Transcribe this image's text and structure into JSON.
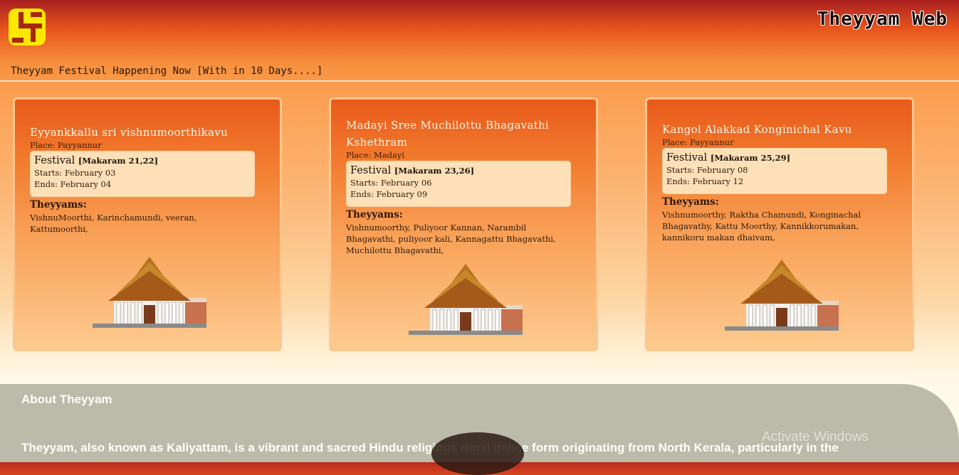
{
  "header": {
    "brand": "Theyyam Web",
    "headline": "Theyyam Festival Happening Now [With in 10 Days....]",
    "logo_icon": "swastika-icon"
  },
  "festivals": [
    {
      "title": "Eyyankkallu sri vishnumoorthikavu",
      "place": "Place: Payyannur",
      "festival_label": "Festival",
      "festival_dates": "[Makaram 21,22]",
      "starts": "Starts: February 03",
      "ends": "Ends: February 04",
      "theyyams_label": "Theyyams:",
      "theyyams": "VishnuMoorthi, Karinchamundi, veeran, Kattumoorthi,"
    },
    {
      "title": "Madayi Sree Muchilottu Bhagavathi Kshethram",
      "place": "Place: Madayi",
      "festival_label": "Festival",
      "festival_dates": "[Makaram 23,26]",
      "starts": "Starts: February 06",
      "ends": "Ends: February 09",
      "theyyams_label": "Theyyams:",
      "theyyams": "Vishnumoorthy, Puliyoor Kannan, Narambil Bhagavathi, puliyoor kali, Kannagattu Bhagavathi, Muchilottu Bhagavathi,"
    },
    {
      "title": "Kangol Alakkad Konginichal Kavu",
      "place": "Place: Payyannur",
      "festival_label": "Festival",
      "festival_dates": "[Makaram 25,29]",
      "starts": "Starts: February 08",
      "ends": "Ends: February 12",
      "theyyams_label": "Theyyams:",
      "theyyams": "Vishnumoorthy, Raktha Chamundi, Konginachal Bhagavathy, Kattu Moorthy, Kannikkorumakan, kannikoru makan dhaivam,"
    }
  ],
  "about": {
    "title": "About Theyyam",
    "text": "Theyyam, also known as Kaliyattam, is a vibrant and sacred Hindu religious ritual dance form originating from North Kerala, particularly in the"
  },
  "watermark": "Activate Windows",
  "colors": {
    "accent": "#e9591b",
    "brand_text": "#1a0a08",
    "logo": "#ffe800"
  }
}
